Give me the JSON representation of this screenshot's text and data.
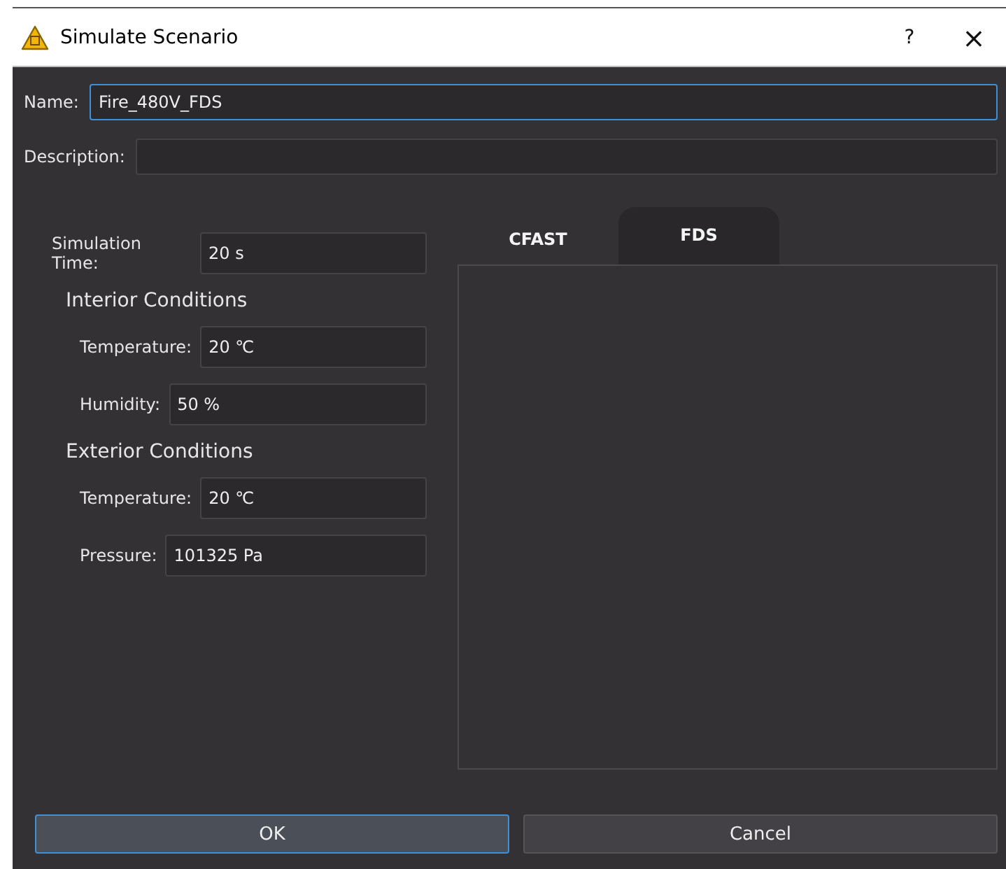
{
  "window": {
    "title": "Simulate Scenario",
    "help": "?",
    "close": "×"
  },
  "name": {
    "label": "Name:",
    "value": "Fire_480V_FDS"
  },
  "description": {
    "label": "Description:"
  },
  "simulation_time": {
    "label": "Simulation Time:",
    "value": "20 s"
  },
  "groups": [
    {
      "title": "Interior Conditions",
      "fields": [
        {
          "label": "Temperature:",
          "value": "20 ℃"
        },
        {
          "label": "Humidity:",
          "value": "50 %"
        }
      ]
    },
    {
      "title": "Exterior Conditions",
      "fields": [
        {
          "label": "Temperature:",
          "value": "20 ℃"
        },
        {
          "label": "Pressure:",
          "value": "101325 Pa"
        }
      ]
    }
  ],
  "tabs": [
    {
      "label": "CFAST",
      "selected": false
    },
    {
      "label": "FDS",
      "selected": true
    }
  ],
  "buttons": [
    {
      "label": "OK",
      "focused": true
    },
    {
      "label": "Cancel",
      "focused": false
    }
  ]
}
